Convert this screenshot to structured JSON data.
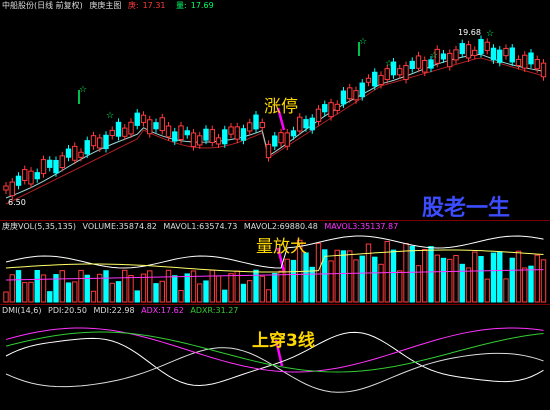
{
  "main_header": {
    "title": "中船股份(日线 前复权)",
    "indicator": "庚庚主图",
    "field1_label": "庚:",
    "field1_value": "17.31",
    "field2_label": "量:",
    "field2_value": "17.69"
  },
  "price_labels": {
    "high": "19.68",
    "low": "6.50"
  },
  "annotations": {
    "limit_up": "涨停",
    "volume_up": "量放大",
    "cross_three": "上穿3线",
    "brand": "股老一生"
  },
  "vol_header": {
    "name": "庚庚VOL(5,35,135)",
    "volume": "VOLUME:35874.82",
    "mavol1": "MAVOL1:63574.73",
    "mavol2": "MAVOL2:69880.48",
    "mavol3": "MAVOL3:35137.87"
  },
  "dmi_header": {
    "name": "DMI(14,6)",
    "pdi": "PDI:20.50",
    "mdi": "MDI:22.98",
    "adx": "ADX:17.62",
    "adxr": "ADXR:31.27"
  },
  "colors": {
    "background": "#000000",
    "up": "#ff3b3b",
    "down": "#00ffff",
    "annotation": "#ffd700",
    "brand": "#3b4dff",
    "arrow": "#ff00ff"
  }
}
